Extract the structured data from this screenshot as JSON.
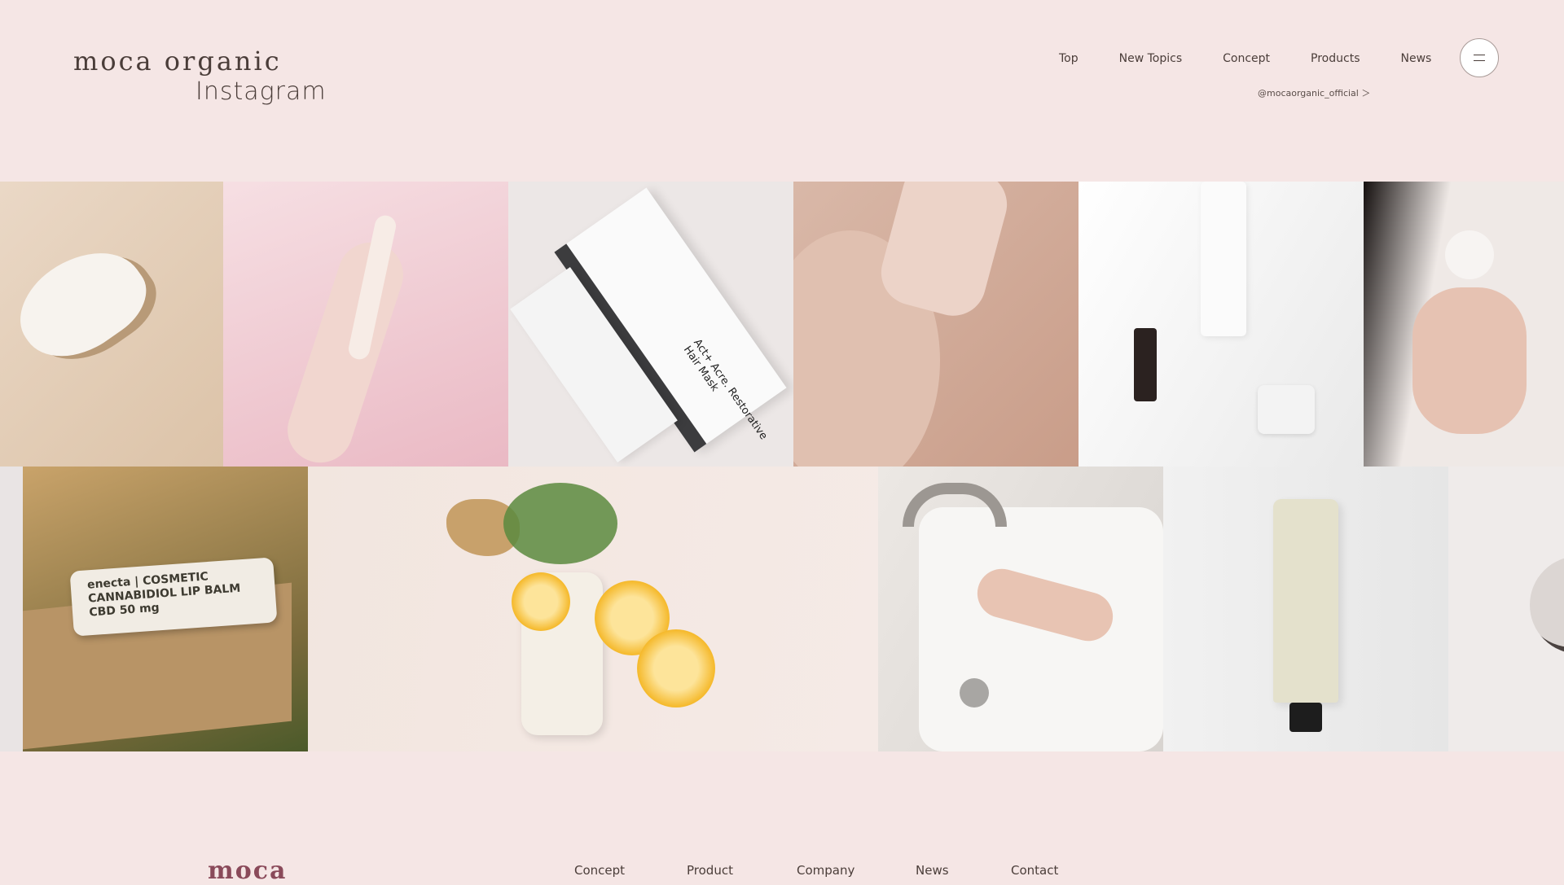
{
  "brand": {
    "name": "moca organic",
    "page_title": "Instagram"
  },
  "nav": {
    "items": [
      "Top",
      "New Topics",
      "Concept",
      "Products",
      "News"
    ]
  },
  "menu_button": {
    "icon": "hamburger-icon"
  },
  "instagram_handle": "@mocaorganic_official ＞",
  "gallery": {
    "photos": [
      {
        "subject": "cream-smear",
        "text": ""
      },
      {
        "subject": "hand-with-lotion",
        "text": ""
      },
      {
        "subject": "act-acre-tubes",
        "text": "Act+ Acre. Restorative Hair Mask"
      },
      {
        "subject": "neck-touch",
        "text": ""
      },
      {
        "subject": "serum-bottles",
        "text": ""
      },
      {
        "subject": "pump-lotion-hands",
        "text": ""
      },
      {
        "subject": "lip-balm",
        "text": "enecta | COSMETIC CANNABIDIOL LIP BALM CBD 50 mg"
      },
      {
        "subject": "ginger-lemon-bottle",
        "text": ""
      },
      {
        "subject": "hand-washing",
        "text": ""
      },
      {
        "subject": "cream-tube",
        "text": ""
      },
      {
        "subject": "partial-cream",
        "text": ""
      }
    ]
  },
  "footer": {
    "brand": "moca",
    "links": [
      "Concept",
      "Product",
      "Company",
      "News",
      "Contact"
    ]
  },
  "colors": {
    "background": "#f5e6e5",
    "text": "#4a3d39",
    "accent": "#8a4a5a"
  }
}
